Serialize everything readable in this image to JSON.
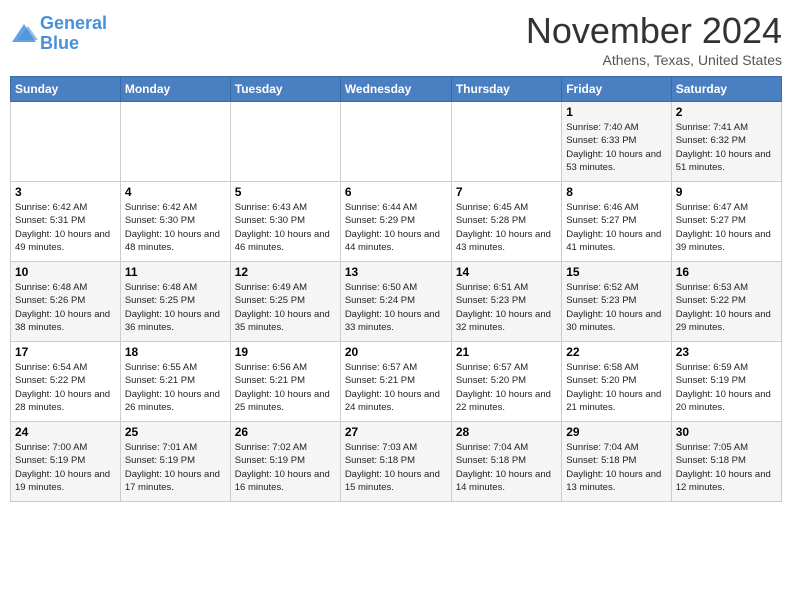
{
  "header": {
    "logo_line1": "General",
    "logo_line2": "Blue",
    "month": "November 2024",
    "location": "Athens, Texas, United States"
  },
  "weekdays": [
    "Sunday",
    "Monday",
    "Tuesday",
    "Wednesday",
    "Thursday",
    "Friday",
    "Saturday"
  ],
  "weeks": [
    [
      {
        "day": "",
        "info": ""
      },
      {
        "day": "",
        "info": ""
      },
      {
        "day": "",
        "info": ""
      },
      {
        "day": "",
        "info": ""
      },
      {
        "day": "",
        "info": ""
      },
      {
        "day": "1",
        "info": "Sunrise: 7:40 AM\nSunset: 6:33 PM\nDaylight: 10 hours and 53 minutes."
      },
      {
        "day": "2",
        "info": "Sunrise: 7:41 AM\nSunset: 6:32 PM\nDaylight: 10 hours and 51 minutes."
      }
    ],
    [
      {
        "day": "3",
        "info": "Sunrise: 6:42 AM\nSunset: 5:31 PM\nDaylight: 10 hours and 49 minutes."
      },
      {
        "day": "4",
        "info": "Sunrise: 6:42 AM\nSunset: 5:30 PM\nDaylight: 10 hours and 48 minutes."
      },
      {
        "day": "5",
        "info": "Sunrise: 6:43 AM\nSunset: 5:30 PM\nDaylight: 10 hours and 46 minutes."
      },
      {
        "day": "6",
        "info": "Sunrise: 6:44 AM\nSunset: 5:29 PM\nDaylight: 10 hours and 44 minutes."
      },
      {
        "day": "7",
        "info": "Sunrise: 6:45 AM\nSunset: 5:28 PM\nDaylight: 10 hours and 43 minutes."
      },
      {
        "day": "8",
        "info": "Sunrise: 6:46 AM\nSunset: 5:27 PM\nDaylight: 10 hours and 41 minutes."
      },
      {
        "day": "9",
        "info": "Sunrise: 6:47 AM\nSunset: 5:27 PM\nDaylight: 10 hours and 39 minutes."
      }
    ],
    [
      {
        "day": "10",
        "info": "Sunrise: 6:48 AM\nSunset: 5:26 PM\nDaylight: 10 hours and 38 minutes."
      },
      {
        "day": "11",
        "info": "Sunrise: 6:48 AM\nSunset: 5:25 PM\nDaylight: 10 hours and 36 minutes."
      },
      {
        "day": "12",
        "info": "Sunrise: 6:49 AM\nSunset: 5:25 PM\nDaylight: 10 hours and 35 minutes."
      },
      {
        "day": "13",
        "info": "Sunrise: 6:50 AM\nSunset: 5:24 PM\nDaylight: 10 hours and 33 minutes."
      },
      {
        "day": "14",
        "info": "Sunrise: 6:51 AM\nSunset: 5:23 PM\nDaylight: 10 hours and 32 minutes."
      },
      {
        "day": "15",
        "info": "Sunrise: 6:52 AM\nSunset: 5:23 PM\nDaylight: 10 hours and 30 minutes."
      },
      {
        "day": "16",
        "info": "Sunrise: 6:53 AM\nSunset: 5:22 PM\nDaylight: 10 hours and 29 minutes."
      }
    ],
    [
      {
        "day": "17",
        "info": "Sunrise: 6:54 AM\nSunset: 5:22 PM\nDaylight: 10 hours and 28 minutes."
      },
      {
        "day": "18",
        "info": "Sunrise: 6:55 AM\nSunset: 5:21 PM\nDaylight: 10 hours and 26 minutes."
      },
      {
        "day": "19",
        "info": "Sunrise: 6:56 AM\nSunset: 5:21 PM\nDaylight: 10 hours and 25 minutes."
      },
      {
        "day": "20",
        "info": "Sunrise: 6:57 AM\nSunset: 5:21 PM\nDaylight: 10 hours and 24 minutes."
      },
      {
        "day": "21",
        "info": "Sunrise: 6:57 AM\nSunset: 5:20 PM\nDaylight: 10 hours and 22 minutes."
      },
      {
        "day": "22",
        "info": "Sunrise: 6:58 AM\nSunset: 5:20 PM\nDaylight: 10 hours and 21 minutes."
      },
      {
        "day": "23",
        "info": "Sunrise: 6:59 AM\nSunset: 5:19 PM\nDaylight: 10 hours and 20 minutes."
      }
    ],
    [
      {
        "day": "24",
        "info": "Sunrise: 7:00 AM\nSunset: 5:19 PM\nDaylight: 10 hours and 19 minutes."
      },
      {
        "day": "25",
        "info": "Sunrise: 7:01 AM\nSunset: 5:19 PM\nDaylight: 10 hours and 17 minutes."
      },
      {
        "day": "26",
        "info": "Sunrise: 7:02 AM\nSunset: 5:19 PM\nDaylight: 10 hours and 16 minutes."
      },
      {
        "day": "27",
        "info": "Sunrise: 7:03 AM\nSunset: 5:18 PM\nDaylight: 10 hours and 15 minutes."
      },
      {
        "day": "28",
        "info": "Sunrise: 7:04 AM\nSunset: 5:18 PM\nDaylight: 10 hours and 14 minutes."
      },
      {
        "day": "29",
        "info": "Sunrise: 7:04 AM\nSunset: 5:18 PM\nDaylight: 10 hours and 13 minutes."
      },
      {
        "day": "30",
        "info": "Sunrise: 7:05 AM\nSunset: 5:18 PM\nDaylight: 10 hours and 12 minutes."
      }
    ]
  ]
}
